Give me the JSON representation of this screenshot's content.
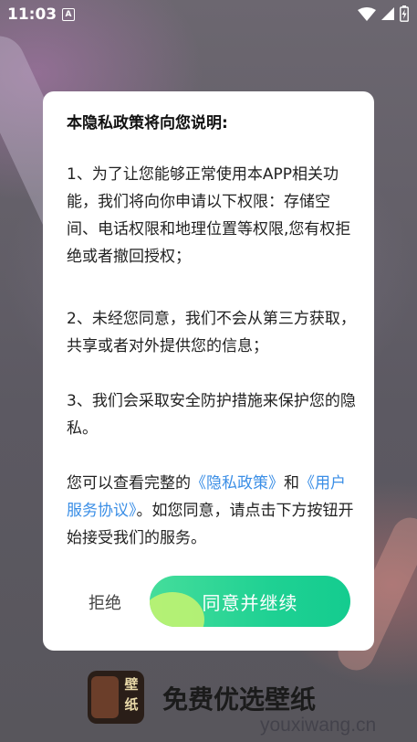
{
  "status_bar": {
    "time": "11:03",
    "notification_icon_letter": "A",
    "icons": [
      "wifi-icon",
      "signal-icon",
      "battery-charging-icon"
    ]
  },
  "dialog": {
    "title": "本隐私政策将向您说明:",
    "paragraph1": "1、为了让您能够正常使用本APP相关功能，我们将向你申请以下权限：存储空间、电话权限和地理位置等权限,您有权拒绝或者撤回授权；",
    "paragraph2": "2、未经您同意，我们不会从第三方获取，共享或者对外提供您的信息；",
    "paragraph3": "3、我们会采取安全防护措施来保护您的隐私。",
    "paragraph4": {
      "prefix": "您可以查看完整的",
      "privacy_link": "《隐私政策》",
      "and": "和",
      "service_link": "《用户服务协议》",
      "suffix": "。如您同意，请点击下方按钮开始接受我们的服务。"
    },
    "reject_label": "拒绝",
    "agree_label": "同意并继续",
    "colors": {
      "link": "#3a8ee6",
      "agree_start": "#45dd9b",
      "agree_end": "#14cc8f"
    }
  },
  "app": {
    "name": "免费优选壁纸",
    "logo_text": "壁纸"
  },
  "watermark": "youxiwang.cn"
}
